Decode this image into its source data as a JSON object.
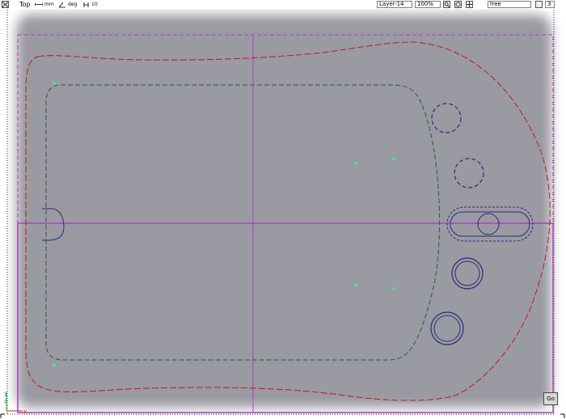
{
  "toolbar": {
    "view_label": "Top",
    "unit": "mm",
    "angle_unit": "deg",
    "step_value": "10",
    "layer_value": "Layer-14",
    "zoom_value": "100%",
    "mode_value": "free",
    "count_value": "3"
  },
  "canvas": {
    "axis_y_label": "y",
    "axis_z_label": "z",
    "axis_x_label": "x",
    "go_button_label": "Go"
  },
  "colors": {
    "background": "#9a9aa3",
    "outline_red": "#c0181e",
    "outline_green": "#2c5a3c",
    "holes_blue": "#2a2a7a",
    "guide_magenta": "#b040c0",
    "markers": "#4fe09a"
  }
}
